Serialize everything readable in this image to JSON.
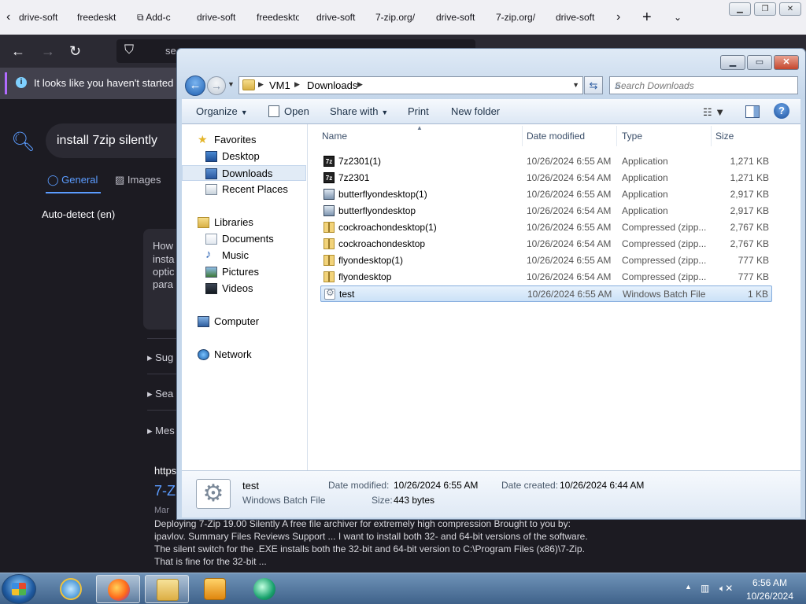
{
  "firefox": {
    "tabs": [
      "drive-soft",
      "freedeskt",
      "Add-c",
      "drive-soft",
      "freedeskto",
      "drive-soft",
      "7-zip.org/",
      "drive-soft",
      "7-zip.org/",
      "drive-soft"
    ],
    "url_text": "se",
    "notification": "It looks like you haven't started Fir",
    "search_query": "install 7zip silently",
    "search_tabs": [
      "General",
      "Images"
    ],
    "autodetect": "Auto-detect (en)",
    "answer_lines": [
      "How",
      "insta",
      "optic",
      "para"
    ],
    "sections": [
      "Sug",
      "Sea",
      "Mes"
    ],
    "result_url": "https:",
    "result_title": "7-Z",
    "result_date": "Mar",
    "snippet_lines": [
      "Deploying 7-Zip 19.00 Silently A free file archiver for extremely high compression Brought to you by:",
      "ipavlov. Summary Files Reviews Support ... I want to install both 32- and 64-bit versions of the software.",
      "The silent switch for the .EXE installs both the 32-bit and 64-bit version to C:\\Program Files (x86)\\7-Zip.",
      "That is fine for the 32-bit ..."
    ]
  },
  "explorer": {
    "breadcrumb": [
      "VM1",
      "Downloads"
    ],
    "search_placeholder": "Search Downloads",
    "commands": {
      "organize": "Organize",
      "open": "Open",
      "share_with": "Share with",
      "print": "Print",
      "new_folder": "New folder"
    },
    "nav": {
      "favorites": "Favorites",
      "desktop": "Desktop",
      "downloads": "Downloads",
      "recent_places": "Recent Places",
      "libraries": "Libraries",
      "documents": "Documents",
      "music": "Music",
      "pictures": "Pictures",
      "videos": "Videos",
      "computer": "Computer",
      "network": "Network"
    },
    "columns": {
      "name": "Name",
      "date_modified": "Date modified",
      "type": "Type",
      "size": "Size"
    },
    "files": [
      {
        "name": "7z2301(1)",
        "date": "10/26/2024 6:55 AM",
        "type": "Application",
        "size": "1,271 KB",
        "icon": "7z-icon"
      },
      {
        "name": "7z2301",
        "date": "10/26/2024 6:54 AM",
        "type": "Application",
        "size": "1,271 KB",
        "icon": "7z-icon"
      },
      {
        "name": "butterflyondesktop(1)",
        "date": "10/26/2024 6:55 AM",
        "type": "Application",
        "size": "2,917 KB",
        "icon": "app-icon"
      },
      {
        "name": "butterflyondesktop",
        "date": "10/26/2024 6:54 AM",
        "type": "Application",
        "size": "2,917 KB",
        "icon": "app-icon"
      },
      {
        "name": "cockroachondesktop(1)",
        "date": "10/26/2024 6:55 AM",
        "type": "Compressed (zipp...",
        "size": "2,767 KB",
        "icon": "zip-icon"
      },
      {
        "name": "cockroachondesktop",
        "date": "10/26/2024 6:54 AM",
        "type": "Compressed (zipp...",
        "size": "2,767 KB",
        "icon": "zip-icon"
      },
      {
        "name": "flyondesktop(1)",
        "date": "10/26/2024 6:55 AM",
        "type": "Compressed (zipp...",
        "size": "777 KB",
        "icon": "zip-icon"
      },
      {
        "name": "flyondesktop",
        "date": "10/26/2024 6:54 AM",
        "type": "Compressed (zipp...",
        "size": "777 KB",
        "icon": "zip-icon"
      },
      {
        "name": "test",
        "date": "10/26/2024 6:55 AM",
        "type": "Windows Batch File",
        "size": "1 KB",
        "icon": "batch-file-icon",
        "selected": true
      }
    ],
    "details": {
      "name": "test",
      "type": "Windows Batch File",
      "date_modified_label": "Date modified:",
      "date_modified": "10/26/2024 6:55 AM",
      "date_created_label": "Date created:",
      "date_created": "10/26/2024 6:44 AM",
      "size_label": "Size:",
      "size": "443 bytes"
    }
  },
  "taskbar": {
    "time": "6:56 AM",
    "date": "10/26/2024"
  }
}
